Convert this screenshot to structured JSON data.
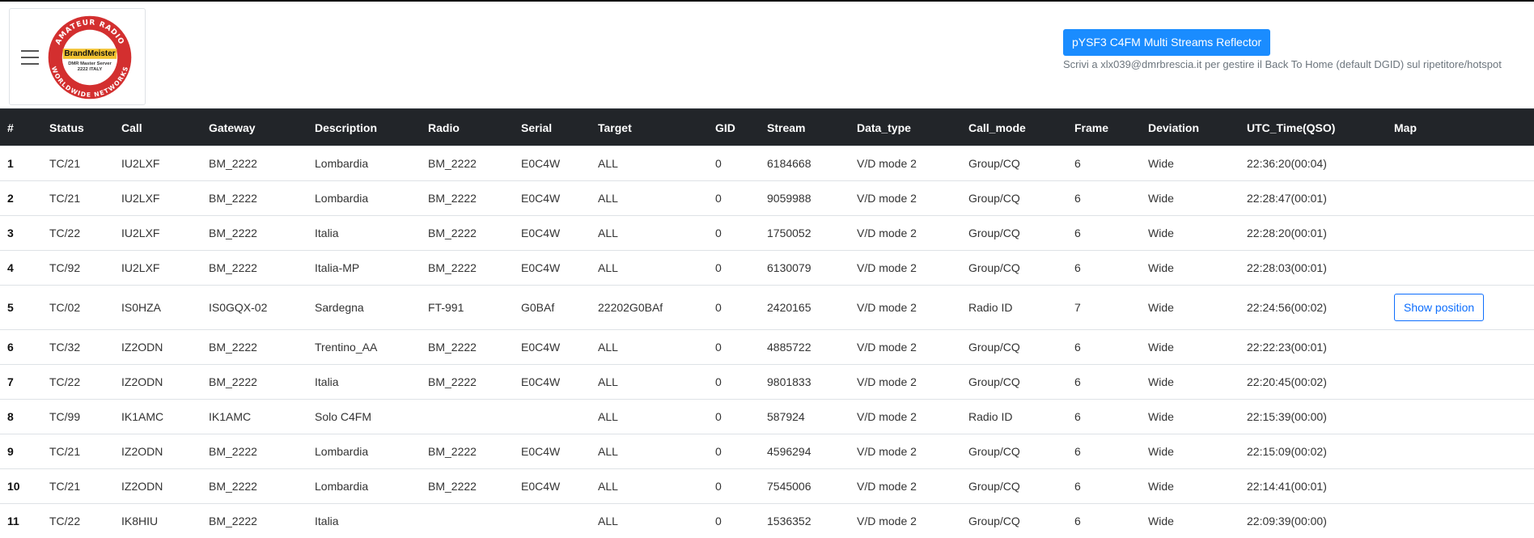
{
  "header": {
    "logo": {
      "top_arc": "AMATEUR RADIO",
      "bottom_arc": "WORLDWIDE NETWORKS",
      "brand": "BrandMeister",
      "line1": "DMR Master Server",
      "line2": "2222 ITALY",
      "ring_color": "#d32f2f"
    },
    "reflector_button": "pYSF3 C4FM Multi Streams Reflector",
    "info_text": "Scrivi a xlx039@dmrbrescia.it per gestire il Back To Home (default DGID) sul ripetitore/hotspot"
  },
  "table": {
    "columns": [
      "#",
      "Status",
      "Call",
      "Gateway",
      "Description",
      "Radio",
      "Serial",
      "Target",
      "GID",
      "Stream",
      "Data_type",
      "Call_mode",
      "Frame",
      "Deviation",
      "UTC_Time(QSO)",
      "Map"
    ],
    "rows": [
      [
        "1",
        "TC/21",
        "IU2LXF",
        "BM_2222",
        "Lombardia",
        "BM_2222",
        "E0C4W",
        "ALL",
        "0",
        "6184668",
        "V/D mode 2",
        "Group/CQ",
        "6",
        "Wide",
        "22:36:20(00:04)",
        ""
      ],
      [
        "2",
        "TC/21",
        "IU2LXF",
        "BM_2222",
        "Lombardia",
        "BM_2222",
        "E0C4W",
        "ALL",
        "0",
        "9059988",
        "V/D mode 2",
        "Group/CQ",
        "6",
        "Wide",
        "22:28:47(00:01)",
        ""
      ],
      [
        "3",
        "TC/22",
        "IU2LXF",
        "BM_2222",
        "Italia",
        "BM_2222",
        "E0C4W",
        "ALL",
        "0",
        "1750052",
        "V/D mode 2",
        "Group/CQ",
        "6",
        "Wide",
        "22:28:20(00:01)",
        ""
      ],
      [
        "4",
        "TC/92",
        "IU2LXF",
        "BM_2222",
        "Italia-MP",
        "BM_2222",
        "E0C4W",
        "ALL",
        "0",
        "6130079",
        "V/D mode 2",
        "Group/CQ",
        "6",
        "Wide",
        "22:28:03(00:01)",
        ""
      ],
      [
        "5",
        "TC/02",
        "IS0HZA",
        "IS0GQX-02",
        "Sardegna",
        "FT-991",
        "G0BAf",
        "22202G0BAf",
        "0",
        "2420165",
        "V/D mode 2",
        "Radio ID",
        "7",
        "Wide",
        "22:24:56(00:02)",
        "Show position"
      ],
      [
        "6",
        "TC/32",
        "IZ2ODN",
        "BM_2222",
        "Trentino_AA",
        "BM_2222",
        "E0C4W",
        "ALL",
        "0",
        "4885722",
        "V/D mode 2",
        "Group/CQ",
        "6",
        "Wide",
        "22:22:23(00:01)",
        ""
      ],
      [
        "7",
        "TC/22",
        "IZ2ODN",
        "BM_2222",
        "Italia",
        "BM_2222",
        "E0C4W",
        "ALL",
        "0",
        "9801833",
        "V/D mode 2",
        "Group/CQ",
        "6",
        "Wide",
        "22:20:45(00:02)",
        ""
      ],
      [
        "8",
        "TC/99",
        "IK1AMC",
        "IK1AMC",
        "Solo C4FM",
        "",
        "",
        "ALL",
        "0",
        "587924",
        "V/D mode 2",
        "Radio ID",
        "6",
        "Wide",
        "22:15:39(00:00)",
        ""
      ],
      [
        "9",
        "TC/21",
        "IZ2ODN",
        "BM_2222",
        "Lombardia",
        "BM_2222",
        "E0C4W",
        "ALL",
        "0",
        "4596294",
        "V/D mode 2",
        "Group/CQ",
        "6",
        "Wide",
        "22:15:09(00:02)",
        ""
      ],
      [
        "10",
        "TC/21",
        "IZ2ODN",
        "BM_2222",
        "Lombardia",
        "BM_2222",
        "E0C4W",
        "ALL",
        "0",
        "7545006",
        "V/D mode 2",
        "Group/CQ",
        "6",
        "Wide",
        "22:14:41(00:01)",
        ""
      ],
      [
        "11",
        "TC/22",
        "IK8HIU",
        "BM_2222",
        "Italia",
        "",
        "",
        "ALL",
        "0",
        "1536352",
        "V/D mode 2",
        "Group/CQ",
        "6",
        "Wide",
        "22:09:39(00:00)",
        ""
      ]
    ]
  }
}
